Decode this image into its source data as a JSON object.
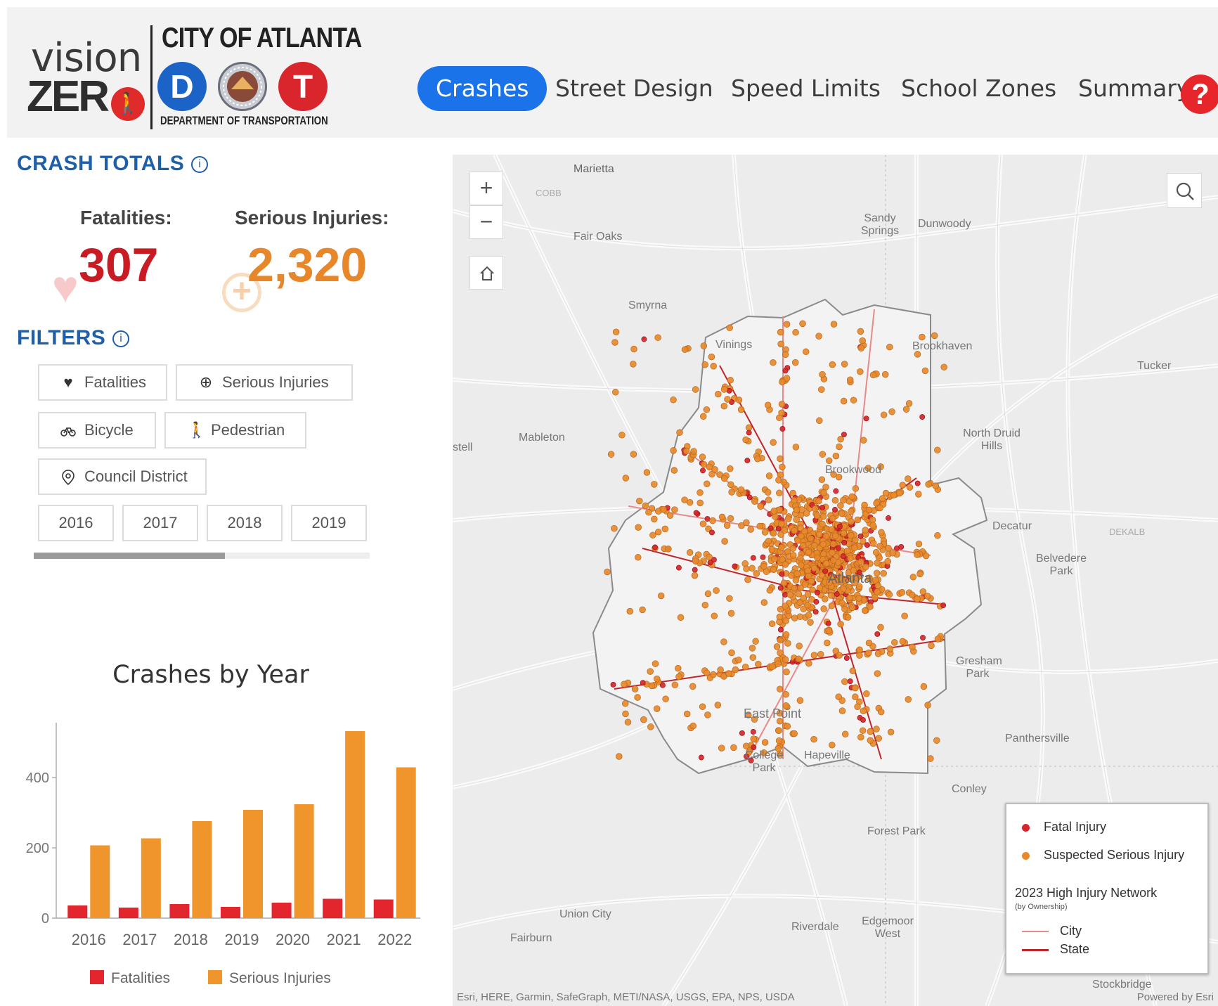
{
  "header": {
    "vision_text": "vision",
    "zero_text": "ZER",
    "city_title": "CITY OF ATLANTA",
    "dot_letters": [
      "D",
      "T"
    ],
    "department": "DEPARTMENT OF TRANSPORTATION",
    "nav_tabs": [
      {
        "label": "Crashes",
        "active": true
      },
      {
        "label": "Street Design",
        "active": false
      },
      {
        "label": "Speed Limits",
        "active": false
      },
      {
        "label": "School Zones",
        "active": false
      },
      {
        "label": "Summary",
        "active": false
      }
    ],
    "help_label": "?"
  },
  "crash_totals": {
    "title": "CRASH TOTALS",
    "fatalities_label": "Fatalities:",
    "fatalities_value": "307",
    "serious_label": "Serious Injuries:",
    "serious_value": "2,320"
  },
  "filters": {
    "title": "FILTERS",
    "chips": [
      {
        "label": "Fatalities",
        "icon": "heart-icon"
      },
      {
        "label": "Serious Injuries",
        "icon": "medical-plus-icon"
      },
      {
        "label": "Bicycle",
        "icon": "bicycle-icon"
      },
      {
        "label": "Pedestrian",
        "icon": "pedestrian-icon"
      },
      {
        "label": "Council District",
        "icon": "location-pin-icon"
      }
    ],
    "years": [
      "2016",
      "2017",
      "2018",
      "2019"
    ]
  },
  "chart_data": {
    "type": "bar",
    "title": "Crashes by Year",
    "categories": [
      "2016",
      "2017",
      "2018",
      "2019",
      "2020",
      "2021",
      "2022"
    ],
    "series": [
      {
        "name": "Fatalities",
        "values": [
          36,
          30,
          40,
          32,
          44,
          55,
          53
        ],
        "color": "#e3262d"
      },
      {
        "name": "Serious Injuries",
        "values": [
          207,
          227,
          276,
          308,
          324,
          532,
          429
        ],
        "color": "#f0952b"
      }
    ],
    "y_ticks": [
      0,
      200,
      400
    ],
    "ylim": [
      0,
      540
    ],
    "legend_position": "bottom",
    "grid": false
  },
  "map": {
    "zoom_in": "+",
    "zoom_out": "−",
    "home_icon": "home-icon",
    "search_icon": "search-icon",
    "places": [
      "Marietta",
      "COBB",
      "Fair Oaks",
      "Sandy Springs",
      "Dunwoody",
      "Smyrna",
      "Vinings",
      "Brookhaven",
      "Tucker",
      "Mableton",
      "stell",
      "North Druid Hills",
      "Brookwood",
      "Decatur",
      "DEKALB",
      "Belvedere Park",
      "Atlanta",
      "Gresham Park",
      "East Point",
      "Panthersville",
      "College Park",
      "Hapeville",
      "Conley",
      "Forest Park",
      "Union City",
      "Riverdale",
      "Edgemoor West",
      "Fairburn",
      "Stockbridge"
    ],
    "legend": {
      "fatal": "Fatal Injury",
      "serious": "Suspected Serious Injury",
      "network_title": "2023 High Injury Network",
      "network_sub": "(by Ownership)",
      "city": "City",
      "state": "State"
    },
    "attribution": "Esri, HERE, Garmin, SafeGraph, METI/NASA, USGS, EPA, NPS, USDA",
    "powered": "Powered by Esri",
    "colors": {
      "fatal": "#d7262c",
      "serious": "#e88a2c",
      "city_line": "#e98a8a",
      "state_line": "#c0252b"
    }
  }
}
